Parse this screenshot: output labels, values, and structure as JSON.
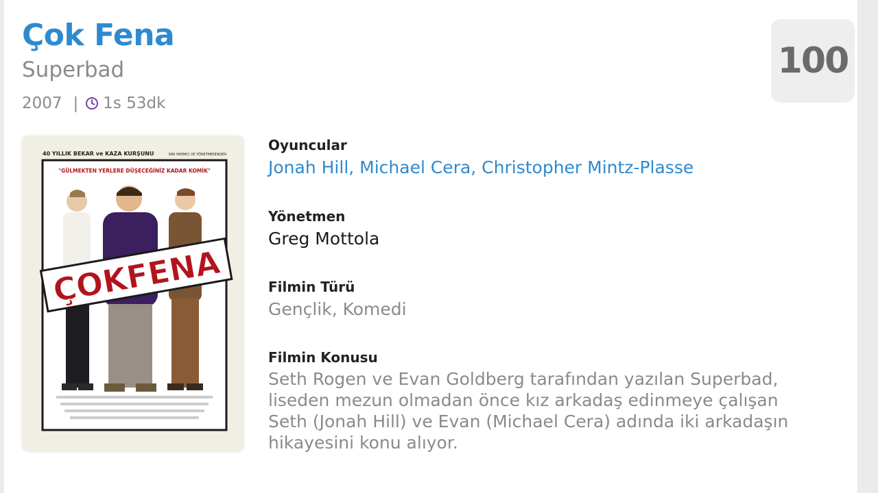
{
  "movie": {
    "title": "Çok Fena",
    "original_title": "Superbad",
    "year": "2007",
    "separator": "|",
    "duration": "1s 53dk",
    "score": "100"
  },
  "poster": {
    "tagline_top": "40 YILLIK BEKAR ve KAZA KURŞUNU",
    "tagline_top_right": "NIN YAPIMCI VE YÖNETMENİNDEN",
    "quote": "\"GÜLMEKTEN YERLERE DÜŞECEĞİNİZ KADAR KOMİK\"",
    "logo_text": "ÇOKFENA"
  },
  "details": {
    "cast_label": "Oyuncular",
    "cast": "Jonah Hill, Michael Cera, Christopher Mintz-Plasse",
    "director_label": "Yönetmen",
    "director": "Greg Mottola",
    "genre_label": "Filmin Türü",
    "genre": "Gençlik, Komedi",
    "plot_label": "Filmin Konusu",
    "plot_lines": [
      "Seth Rogen ve Evan Goldberg tarafından yazılan Superbad,",
      "liseden mezun olmadan önce kız arkadaş edinmeye çalışan",
      "Seth (Jonah Hill) ve Evan (Michael Cera) adında iki arkadaşın",
      "hikayesini konu alıyor."
    ]
  },
  "colors": {
    "accent": "#2e8ad0",
    "muted": "#8a8a8a",
    "clock_icon": "#7b3fa6"
  }
}
